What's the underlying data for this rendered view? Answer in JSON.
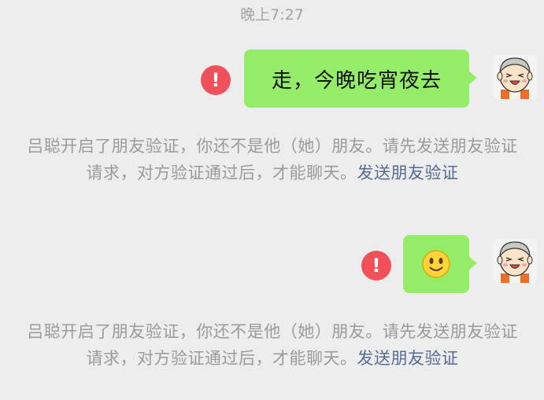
{
  "chat": {
    "timestamp": "晚上7:27",
    "messages": [
      {
        "text": "走，今晚吃宵夜去",
        "status": "failed"
      },
      {
        "emoji": "smiley",
        "status": "failed"
      }
    ],
    "notice": {
      "text": "吕聪开启了朋友验证，你还不是他（她）朋友。请先发送朋友验证请求，对方验证通过后，才能聊天。",
      "link": "发送朋友验证"
    },
    "error_symbol": "!"
  },
  "colors": {
    "bubble": "#95ec69",
    "error": "#f0505a",
    "link": "#586b94",
    "background": "#ededed",
    "system_text": "#9b9b9b"
  },
  "icons": {
    "avatar": "cartoon-grandpa-avatar",
    "error": "exclamation-circle-icon",
    "emoji": "smiley-emoji"
  }
}
